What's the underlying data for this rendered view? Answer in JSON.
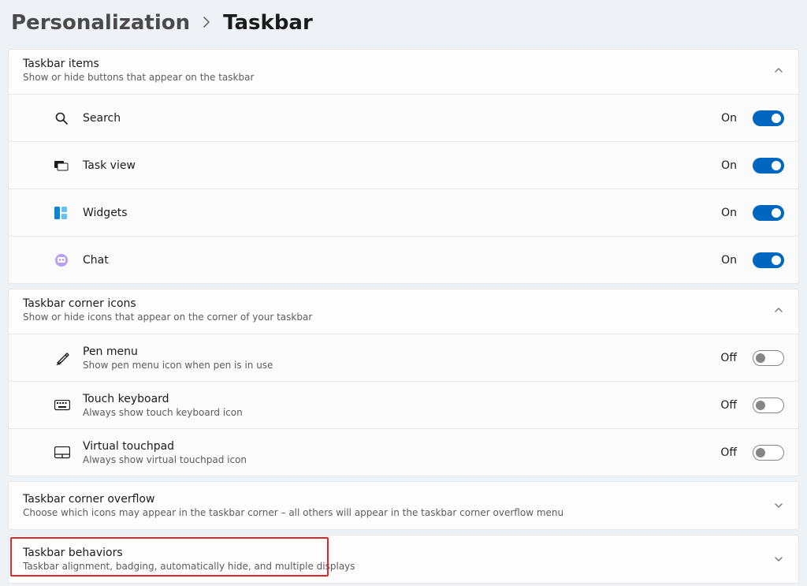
{
  "breadcrumb": {
    "parent": "Personalization",
    "page": "Taskbar"
  },
  "labels": {
    "on": "On",
    "off": "Off"
  },
  "sections": {
    "items": {
      "title": "Taskbar items",
      "sub": "Show or hide buttons that appear on the taskbar",
      "rows": {
        "search": {
          "label": "Search",
          "state": "on"
        },
        "taskview": {
          "label": "Task view",
          "state": "on"
        },
        "widgets": {
          "label": "Widgets",
          "state": "on"
        },
        "chat": {
          "label": "Chat",
          "state": "on"
        }
      }
    },
    "corner_icons": {
      "title": "Taskbar corner icons",
      "sub": "Show or hide icons that appear on the corner of your taskbar",
      "rows": {
        "pen": {
          "label": "Pen menu",
          "desc": "Show pen menu icon when pen is in use",
          "state": "off"
        },
        "touchkb": {
          "label": "Touch keyboard",
          "desc": "Always show touch keyboard icon",
          "state": "off"
        },
        "touchpad": {
          "label": "Virtual touchpad",
          "desc": "Always show virtual touchpad icon",
          "state": "off"
        }
      }
    },
    "overflow": {
      "title": "Taskbar corner overflow",
      "sub": "Choose which icons may appear in the taskbar corner – all others will appear in the taskbar corner overflow menu"
    },
    "behaviors": {
      "title": "Taskbar behaviors",
      "sub": "Taskbar alignment, badging, automatically hide, and multiple displays"
    }
  }
}
